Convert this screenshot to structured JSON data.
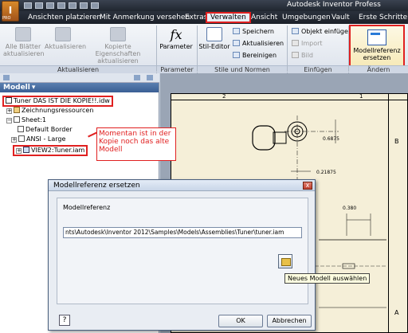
{
  "app": {
    "logo_text": "I",
    "pro_badge": "PRO",
    "title": "Autodesk Inventor Profess"
  },
  "tabs": [
    {
      "label": "Ansichten platzieren"
    },
    {
      "label": "Mit Anmerkung versehen"
    },
    {
      "label": "Extras"
    },
    {
      "label": "Verwalten"
    },
    {
      "label": "Ansicht"
    },
    {
      "label": "Umgebungen"
    },
    {
      "label": "Vault"
    },
    {
      "label": "Erste Schritte"
    }
  ],
  "ribbon": {
    "aktualisieren": {
      "buttons": [
        "Alle Blätter aktualisieren",
        "Aktualisieren",
        "Kopierte Eigenschaften aktualisieren"
      ],
      "group_label": "Aktualisieren"
    },
    "parameter": {
      "button": "Parameter",
      "group_label": "Parameter",
      "fx": "fx"
    },
    "stile": {
      "button": "Stil-Editor",
      "items": [
        "Speichern",
        "Aktualisieren",
        "Bereinigen"
      ],
      "group_label": "Stile und Normen"
    },
    "einfuegen": {
      "items": [
        "Objekt einfügen",
        "Import",
        "Bild"
      ],
      "group_label": "Einfügen"
    },
    "aendern": {
      "button_line1": "Modellreferenz",
      "button_line2": "ersetzen",
      "group_label": "Ändern"
    }
  },
  "browser": {
    "header": "Modell",
    "items": [
      {
        "label": "Tuner DAS IST DIE KOPIE!!.idw"
      },
      {
        "label": "Zeichnungsressourcen"
      },
      {
        "label": "Sheet:1"
      },
      {
        "label": "Default Border"
      },
      {
        "label": "ANSI - Large"
      },
      {
        "label": "VIEW2:Tuner.iam"
      }
    ],
    "callout": "Momentan ist in der Kopie noch das alte Modell"
  },
  "drawing": {
    "col_labels": [
      "2",
      "1"
    ],
    "row_labels": [
      "B",
      "A"
    ],
    "dims": [
      "0.6875",
      "0.21875",
      "0.380"
    ]
  },
  "dialog": {
    "title": "Modellreferenz ersetzen",
    "close_label": "x",
    "frame_label": "Modellreferenz",
    "path": "nts\\Autodesk\\Inventor 2012\\Samples\\Models\\Assemblies\\Tuner\\tuner.iam",
    "help_label": "?",
    "ok_label": "OK",
    "cancel_label": "Abbrechen",
    "tooltip": "Neues Modell auswählen"
  }
}
